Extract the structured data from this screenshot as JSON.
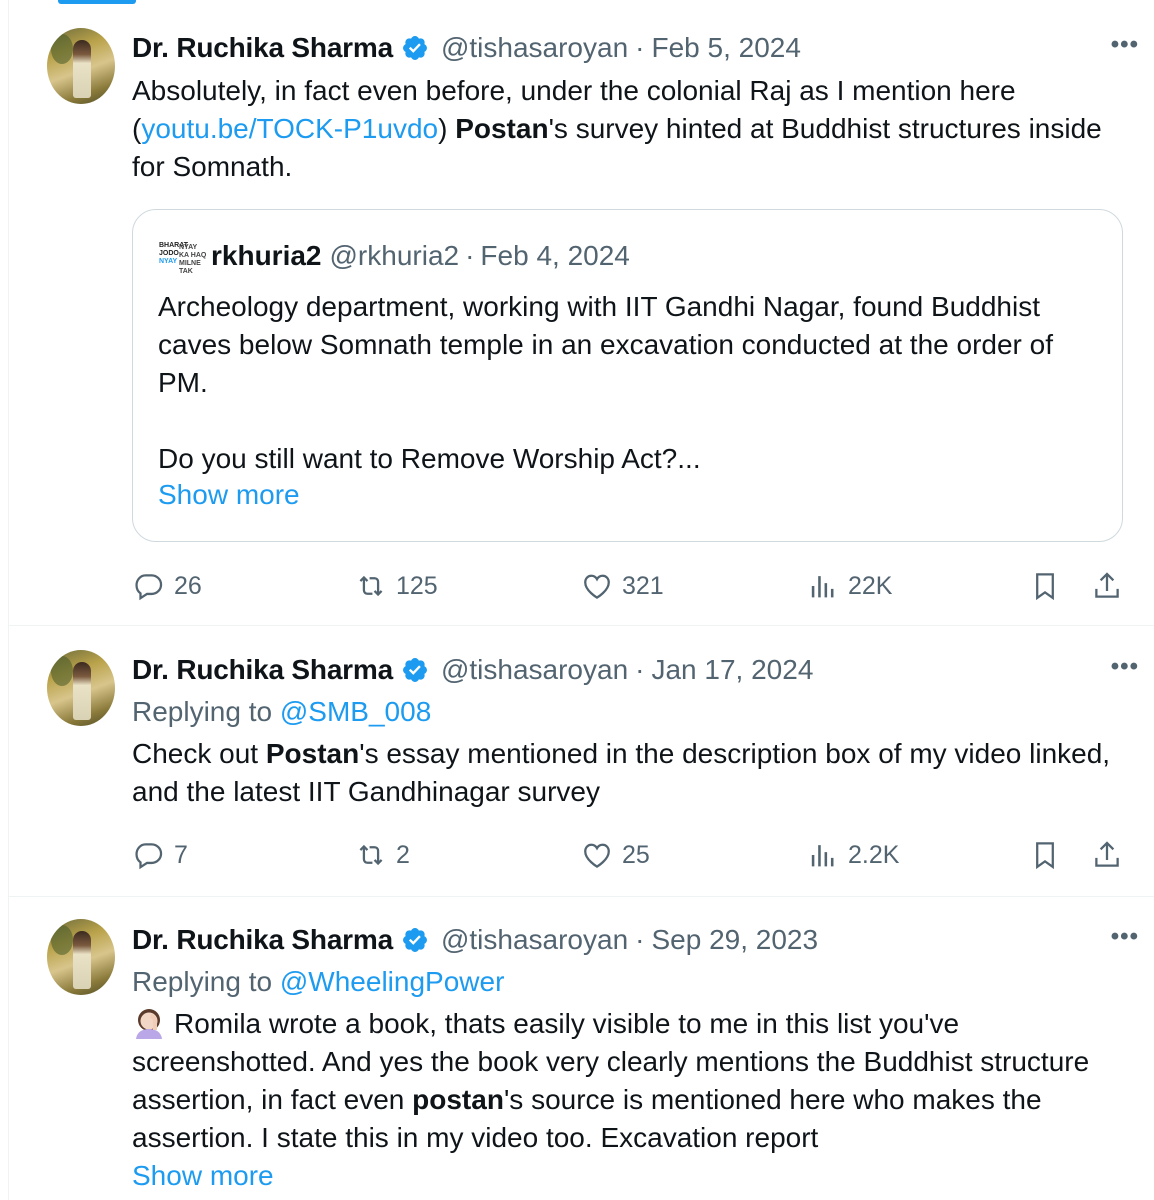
{
  "tweets": [
    {
      "name": "Dr. Ruchika Sharma",
      "handle": "@tishasaroyan",
      "separator": "·",
      "date": "Feb 5, 2024",
      "more": "•••",
      "text_parts": {
        "p1": "Absolutely, in fact even before, under the colonial Raj as I mention here (",
        "link": "youtu.be/TOCK-P1uvdo",
        "p2": ") ",
        "bold": "Postan",
        "p3": "'s survey hinted at Buddhist structures inside for Somnath."
      },
      "quote": {
        "name": "rkhuria2",
        "handle": "@rkhuria2",
        "separator": "·",
        "date": "Feb 4, 2024",
        "line1": "Archeology department, working with IIT Gandhi Nagar, found Buddhist caves below Somnath temple in an excavation conducted at the order of PM.",
        "line2": "Do you still want to Remove Worship Act?...",
        "show_more": "Show more"
      },
      "stats": {
        "replies": "26",
        "reposts": "125",
        "likes": "321",
        "views": "22K"
      }
    },
    {
      "name": "Dr. Ruchika Sharma",
      "handle": "@tishasaroyan",
      "separator": "·",
      "date": "Jan 17, 2024",
      "more": "•••",
      "replying_label": "Replying to ",
      "replying_to": "@SMB_008",
      "text_parts": {
        "p1": "Check out ",
        "bold": "Postan",
        "p2": "'s essay mentioned in the description box of my video linked, and the latest IIT Gandhinagar survey"
      },
      "stats": {
        "replies": "7",
        "reposts": "2",
        "likes": "25",
        "views": "2.2K"
      }
    },
    {
      "name": "Dr. Ruchika Sharma",
      "handle": "@tishasaroyan",
      "separator": "·",
      "date": "Sep 29, 2023",
      "more": "•••",
      "replying_label": "Replying to ",
      "replying_to": "@WheelingPower",
      "emoji": "face-palm-woman",
      "text_parts": {
        "p1": "Romila wrote a book, thats easily visible to me in this list you've screenshotted. And yes the book very clearly mentions the Buddhist structure assertion, in fact even ",
        "bold": "postan",
        "p2": "'s source is mentioned here who makes the assertion. I state this in my video too. Excavation report"
      },
      "show_more": "Show more"
    }
  ],
  "colors": {
    "link": "#1d9bf0",
    "secondary": "#536471",
    "text": "#0f1419",
    "border": "#cfd9de"
  }
}
